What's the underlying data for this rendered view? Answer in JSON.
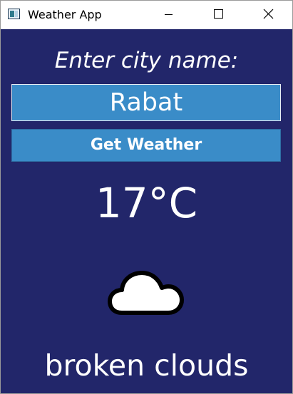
{
  "window": {
    "title": "Weather App",
    "controls": {
      "minimize_icon": "minimize-icon",
      "maximize_icon": "maximize-icon",
      "close_icon": "close-icon"
    }
  },
  "form": {
    "prompt": "Enter city name:",
    "city_value": "Rabat",
    "button_label": "Get Weather"
  },
  "weather": {
    "temperature": "17°C",
    "icon": "cloud-icon",
    "description": "broken clouds"
  },
  "colors": {
    "background": "#22266a",
    "accent": "#3a8cc8",
    "text": "#ffffff"
  }
}
